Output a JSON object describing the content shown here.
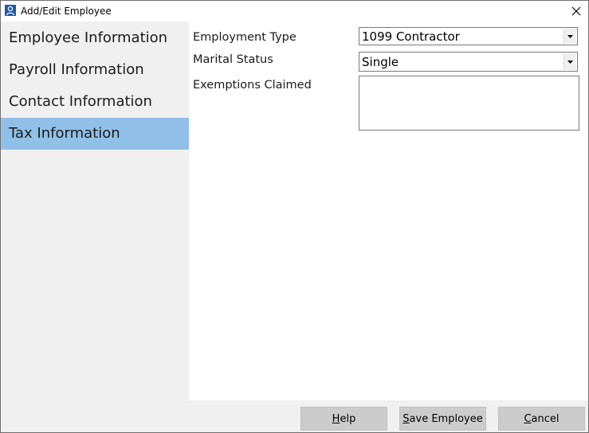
{
  "window": {
    "title": "Add/Edit Employee",
    "icon": "person-icon"
  },
  "sidebar": {
    "items": [
      {
        "label": "Employee Information",
        "active": false
      },
      {
        "label": "Payroll Information",
        "active": false
      },
      {
        "label": "Contact Information",
        "active": false
      },
      {
        "label": "Tax Information",
        "active": true
      }
    ],
    "active_color": "#90c0e8"
  },
  "form": {
    "employment_type": {
      "label": "Employment Type",
      "value": "1099 Contractor"
    },
    "marital_status": {
      "label": "Marital Status",
      "value": "Single"
    },
    "exemptions_claimed": {
      "label": "Exemptions Claimed",
      "value": ""
    }
  },
  "footer": {
    "help": {
      "prefix": "",
      "mnemonic": "H",
      "rest": "elp"
    },
    "save": {
      "prefix": "",
      "mnemonic": "S",
      "rest": "ave Employee"
    },
    "cancel": {
      "prefix": "",
      "mnemonic": "C",
      "rest": "ancel"
    }
  }
}
